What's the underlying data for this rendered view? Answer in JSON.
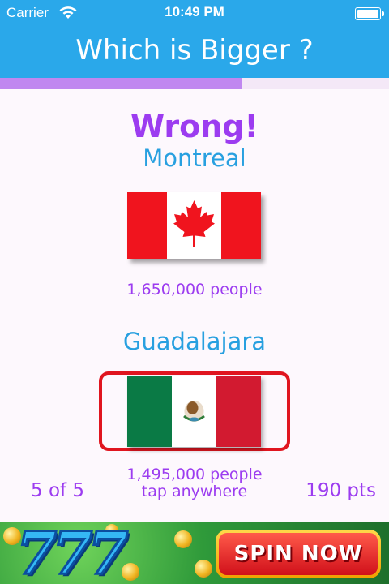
{
  "status_bar": {
    "carrier": "Carrier",
    "time": "10:49 PM",
    "icons": [
      "wifi-icon",
      "battery-icon"
    ]
  },
  "header": {
    "title": "Which is Bigger ?"
  },
  "quiz": {
    "progress_fraction": 0.62,
    "result_text": "Wrong!",
    "cities": [
      {
        "name": "Montreal",
        "population": "1,650,000 people",
        "flag": "canada-flag-icon"
      },
      {
        "name": "Guadalajara",
        "population": "1,495,000 people",
        "flag": "mexico-flag-icon"
      }
    ],
    "question_count": "5 of 5",
    "hint": "tap anywhere",
    "score": "190 pts"
  },
  "ad": {
    "button_label": "SPIN NOW",
    "logo_text": "777"
  },
  "colors": {
    "accent_blue": "#2aa8ea",
    "accent_purple": "#9c3cf0",
    "highlight_red": "#e0151f",
    "progress_purple": "#c087f0"
  }
}
